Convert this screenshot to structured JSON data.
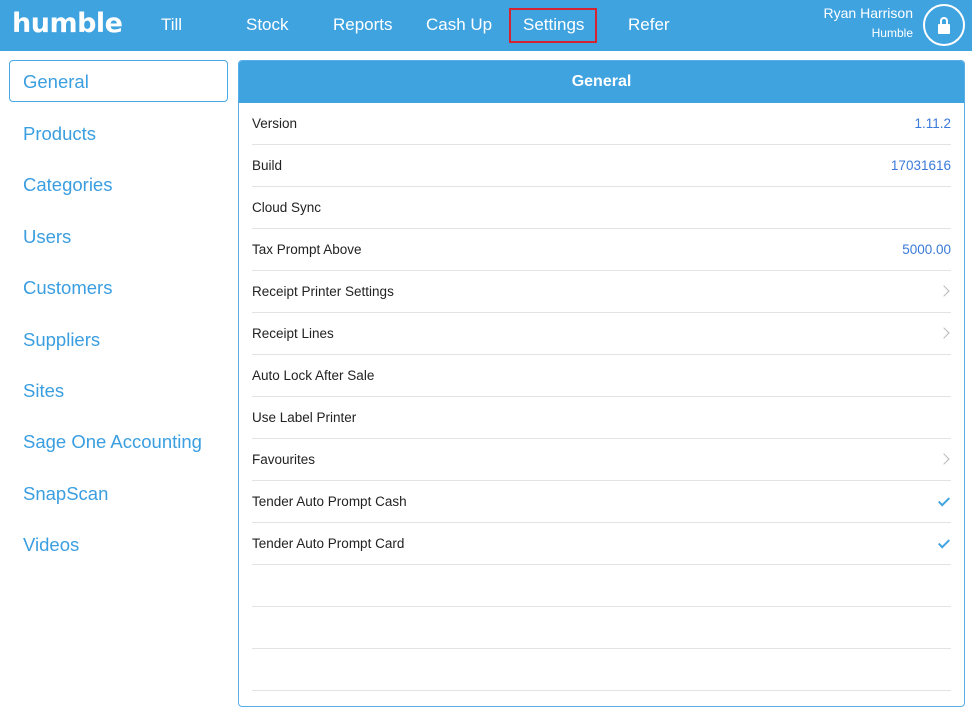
{
  "app": {
    "logo": "humble"
  },
  "nav": {
    "items": [
      {
        "label": "Till"
      },
      {
        "label": "Stock"
      },
      {
        "label": "Reports"
      },
      {
        "label": "Cash Up"
      },
      {
        "label": "Settings"
      },
      {
        "label": "Refer"
      }
    ],
    "active": "Settings"
  },
  "user": {
    "name": "Ryan Harrison",
    "org": "Humble",
    "lock_icon": "lock-icon"
  },
  "sidebar": {
    "items": [
      {
        "label": "General"
      },
      {
        "label": "Products"
      },
      {
        "label": "Categories"
      },
      {
        "label": "Users"
      },
      {
        "label": "Customers"
      },
      {
        "label": "Suppliers"
      },
      {
        "label": "Sites"
      },
      {
        "label": "Sage One Accounting"
      },
      {
        "label": "SnapScan"
      },
      {
        "label": "Videos"
      }
    ],
    "selected": "General"
  },
  "panel": {
    "title": "General",
    "rows": [
      {
        "label": "Version",
        "value": "1.11.2",
        "accessory": "none"
      },
      {
        "label": "Build",
        "value": "17031616",
        "accessory": "none"
      },
      {
        "label": "Cloud Sync",
        "value": "",
        "accessory": "none"
      },
      {
        "label": "Tax Prompt Above",
        "value": "5000.00",
        "accessory": "none"
      },
      {
        "label": "Receipt Printer Settings",
        "value": "",
        "accessory": "chevron-right-icon"
      },
      {
        "label": "Receipt Lines",
        "value": "",
        "accessory": "chevron-right-icon"
      },
      {
        "label": "Auto Lock After Sale",
        "value": "",
        "accessory": "none"
      },
      {
        "label": "Use Label Printer",
        "value": "",
        "accessory": "none"
      },
      {
        "label": "Favourites",
        "value": "",
        "accessory": "chevron-right-icon"
      },
      {
        "label": "Tender Auto Prompt Cash",
        "value": "",
        "accessory": "checkmark-icon"
      },
      {
        "label": "Tender Auto Prompt Card",
        "value": "",
        "accessory": "checkmark-icon"
      }
    ],
    "empty_rows": 3
  },
  "colors": {
    "brand": "#3fa3e0",
    "link": "#3a9ee0",
    "value": "#3a7ad9",
    "active_outline": "#d5232f"
  }
}
